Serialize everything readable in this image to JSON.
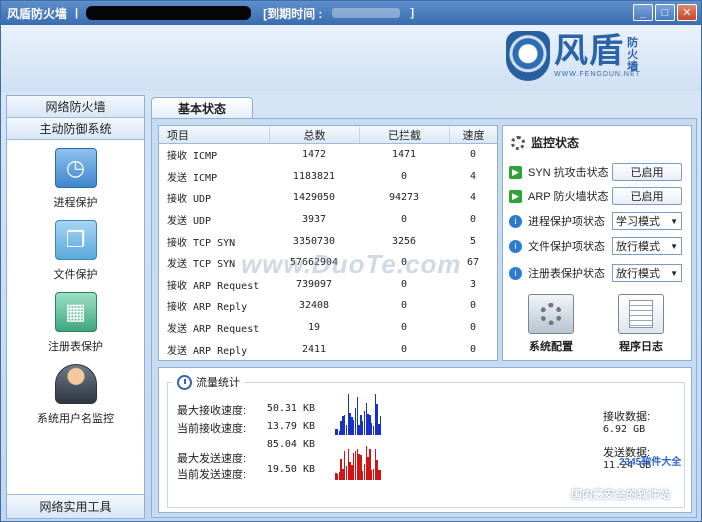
{
  "titlebar": {
    "app_name": "风盾防火墙",
    "separator": "|",
    "expire_label": "[到期时间 :",
    "end_bracket": "]",
    "buttons": [
      "_",
      "□",
      "✕"
    ]
  },
  "logo": {
    "main": "风盾",
    "side": "防火墙",
    "url": "WWW.FENGDUN.NET"
  },
  "sidebar": {
    "sections": [
      "网络防火墙",
      "主动防御系统"
    ],
    "items": [
      {
        "label": "进程保护",
        "icon": "process-clock-icon"
      },
      {
        "label": "文件保护",
        "icon": "file-shield-icon"
      },
      {
        "label": "注册表保护",
        "icon": "registry-icon"
      },
      {
        "label": "系统用户名监控",
        "icon": "user-icon"
      }
    ],
    "footer": "网络实用工具"
  },
  "main": {
    "tab": "基本状态"
  },
  "stats": {
    "headers": [
      "项目",
      "总数",
      "已拦截",
      "速度"
    ],
    "rows": [
      [
        "接收 ICMP",
        "1472",
        "1471",
        "0"
      ],
      [
        "发送 ICMP",
        "1183821",
        "0",
        "4"
      ],
      [
        "接收 UDP",
        "1429050",
        "94273",
        "4"
      ],
      [
        "发送 UDP",
        "3937",
        "0",
        "0"
      ],
      [
        "接收 TCP SYN",
        "3350730",
        "3256",
        "5"
      ],
      [
        "发送 TCP SYN",
        "57662904",
        "0",
        "67"
      ],
      [
        "接收 ARP Request",
        "739097",
        "0",
        "3"
      ],
      [
        "接收 ARP Reply",
        "32408",
        "0",
        "0"
      ],
      [
        "发送 ARP Request",
        "19",
        "0",
        "0"
      ],
      [
        "发送 ARP Reply",
        "2411",
        "0",
        "0"
      ]
    ]
  },
  "monitor": {
    "title": "监控状态",
    "rows": [
      {
        "label": "SYN 抗攻击状态",
        "control": "button",
        "value": "已启用",
        "icon": "green"
      },
      {
        "label": "ARP 防火墙状态",
        "control": "button",
        "value": "已启用",
        "icon": "green"
      },
      {
        "label": "进程保护项状态",
        "control": "select",
        "value": "学习模式",
        "icon": "blue"
      },
      {
        "label": "文件保护项状态",
        "control": "select",
        "value": "放行模式",
        "icon": "blue"
      },
      {
        "label": "注册表保护状态",
        "control": "select",
        "value": "放行模式",
        "icon": "blue"
      }
    ],
    "tools": [
      "系统配置",
      "程序日志"
    ]
  },
  "traffic": {
    "title": "流量统计",
    "max_recv_label": "最大接收速度:",
    "max_recv": "50.31 KB",
    "cur_recv_label": "当前接收速度:",
    "cur_recv": "13.79 KB",
    "max_send": "85.04 KB",
    "max_send_label": "最大发送速度:",
    "cur_send_label": "当前发送速度:",
    "cur_send": "19.50 KB",
    "recv_total_label": "接收数据:",
    "recv_total": "6.92 GB",
    "send_total_label": "发送数据:",
    "send_total": "11.24 GB",
    "recv_color": "#1630c8",
    "send_color": "#d41414"
  },
  "watermarks": {
    "center": "www.DuoTe.com",
    "bottom": "国内最安全的软件站",
    "brand": "2345软件大全"
  }
}
